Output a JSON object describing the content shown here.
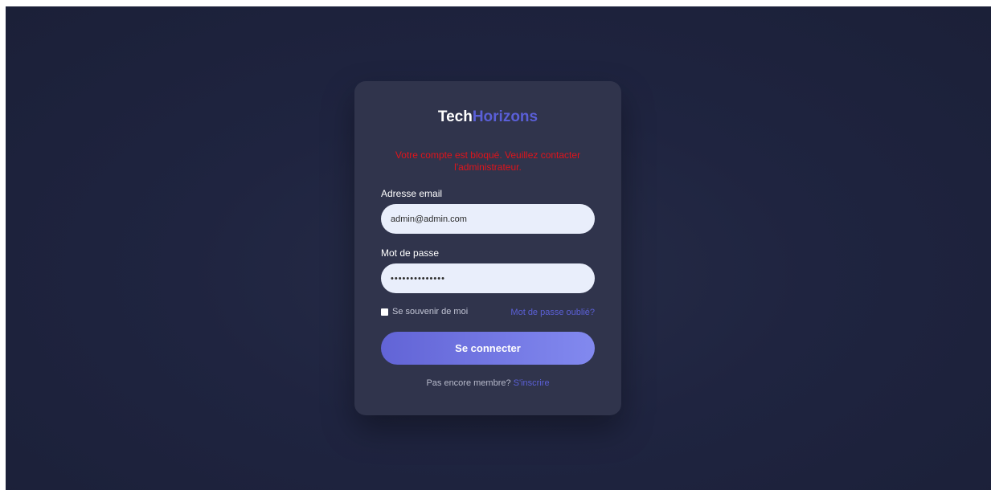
{
  "brand": {
    "part1": "Tech",
    "part2": "Horizons",
    "accent_color": "#5a5fd8"
  },
  "error_message": "Votre compte est bloqué. Veuillez contacter l'administrateur.",
  "form": {
    "email": {
      "label": "Adresse email",
      "value": "admin@admin.com"
    },
    "password": {
      "label": "Mot de passe",
      "value": "••••••••••••••"
    },
    "remember_label": "Se souvenir de moi",
    "forgot_label": "Mot de passe oublié?",
    "submit_label": "Se connecter"
  },
  "signup": {
    "prompt": "Pas encore membre?",
    "link_label": "S'inscrire"
  },
  "colors": {
    "error": "#e0141b",
    "link": "#5b60d6",
    "background": "#1f2440",
    "card": "#30344c"
  }
}
